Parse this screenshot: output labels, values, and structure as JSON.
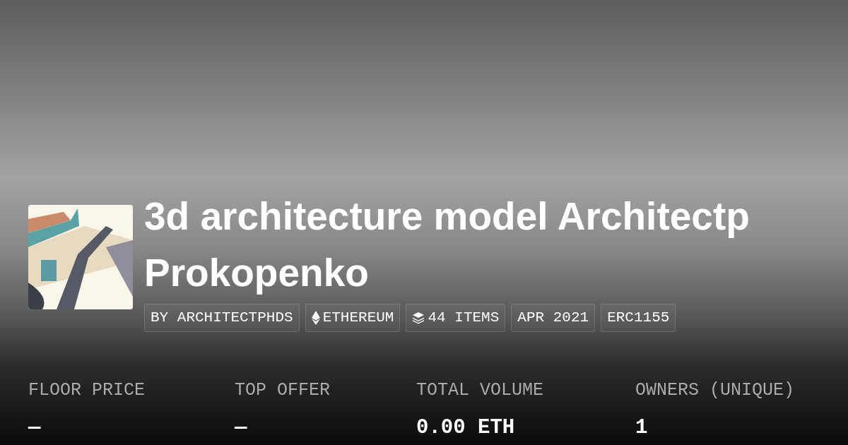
{
  "collection": {
    "title_lines": [
      "3d architecture model Architectp",
      "Prokopenko"
    ],
    "tags": [
      {
        "kind": "creator",
        "label": "BY ARCHITECTPHDS"
      },
      {
        "kind": "chain",
        "label": "ETHEREUM"
      },
      {
        "kind": "items",
        "label": "44 ITEMS"
      },
      {
        "kind": "date",
        "label": "APR 2021"
      },
      {
        "kind": "standard",
        "label": "ERC1155"
      }
    ]
  },
  "stats": [
    {
      "label": "FLOOR PRICE",
      "value": "—"
    },
    {
      "label": "TOP OFFER",
      "value": "—"
    },
    {
      "label": "TOTAL VOLUME",
      "value": "0.00 ETH"
    },
    {
      "label": "OWNERS (UNIQUE)",
      "value": "1"
    }
  ]
}
